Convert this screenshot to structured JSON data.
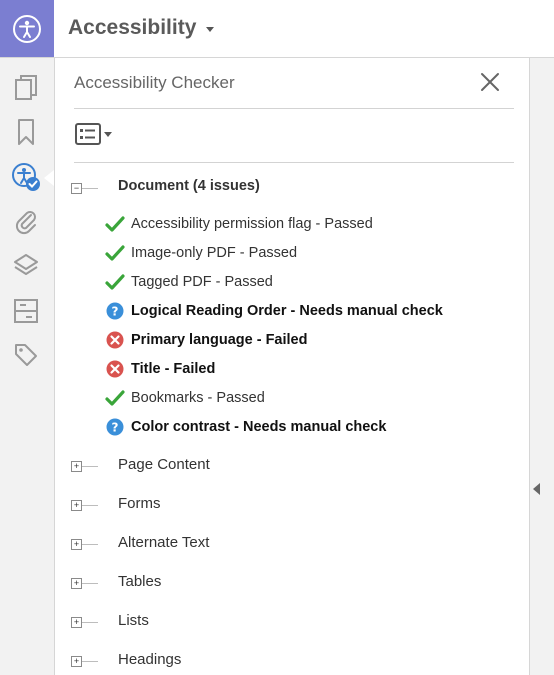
{
  "header": {
    "title": "Accessibility"
  },
  "toolbar": {
    "tools": [
      "pages-icon",
      "bookmark-icon",
      "accessibility-icon",
      "attachment-icon",
      "layers-icon",
      "structure-icon",
      "tags-icon"
    ],
    "active": "accessibility-icon"
  },
  "panel": {
    "title": "Accessibility Checker",
    "document_group": {
      "label": "Document (4 issues)",
      "items": [
        {
          "label": "Accessibility permission flag - Passed",
          "status": "passed",
          "bold": false
        },
        {
          "label": "Image-only PDF - Passed",
          "status": "passed",
          "bold": false
        },
        {
          "label": "Tagged PDF - Passed",
          "status": "passed",
          "bold": false
        },
        {
          "label": "Logical Reading Order - Needs manual check",
          "status": "manual",
          "bold": true
        },
        {
          "label": "Primary language - Failed",
          "status": "failed",
          "bold": true
        },
        {
          "label": "Title - Failed",
          "status": "failed",
          "bold": true
        },
        {
          "label": "Bookmarks - Passed",
          "status": "passed",
          "bold": false
        },
        {
          "label": "Color contrast - Needs manual check",
          "status": "manual",
          "bold": true
        }
      ]
    },
    "collapsed_groups": [
      "Page Content",
      "Forms",
      "Alternate Text",
      "Tables",
      "Lists",
      "Headings"
    ]
  },
  "colors": {
    "brand": "#7b7ed1",
    "passed": "#3aa53a",
    "failed": "#d9534f",
    "manual": "#3a8fd9"
  }
}
